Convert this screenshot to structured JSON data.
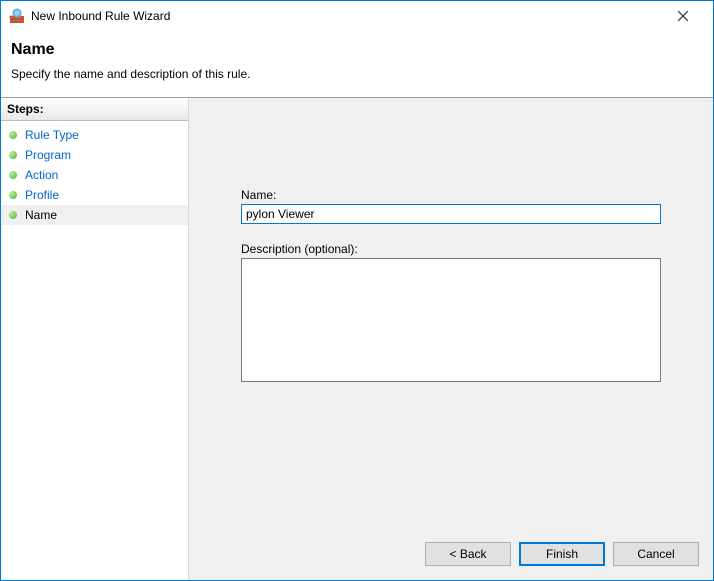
{
  "window": {
    "title": "New Inbound Rule Wizard"
  },
  "header": {
    "title": "Name",
    "subtitle": "Specify the name and description of this rule."
  },
  "steps": {
    "heading": "Steps:",
    "items": [
      {
        "label": "Rule Type",
        "current": false
      },
      {
        "label": "Program",
        "current": false
      },
      {
        "label": "Action",
        "current": false
      },
      {
        "label": "Profile",
        "current": false
      },
      {
        "label": "Name",
        "current": true
      }
    ]
  },
  "form": {
    "name_label": "Name:",
    "name_value": "pylon Viewer",
    "desc_label": "Description (optional):",
    "desc_value": ""
  },
  "buttons": {
    "back": "< Back",
    "finish": "Finish",
    "cancel": "Cancel"
  }
}
